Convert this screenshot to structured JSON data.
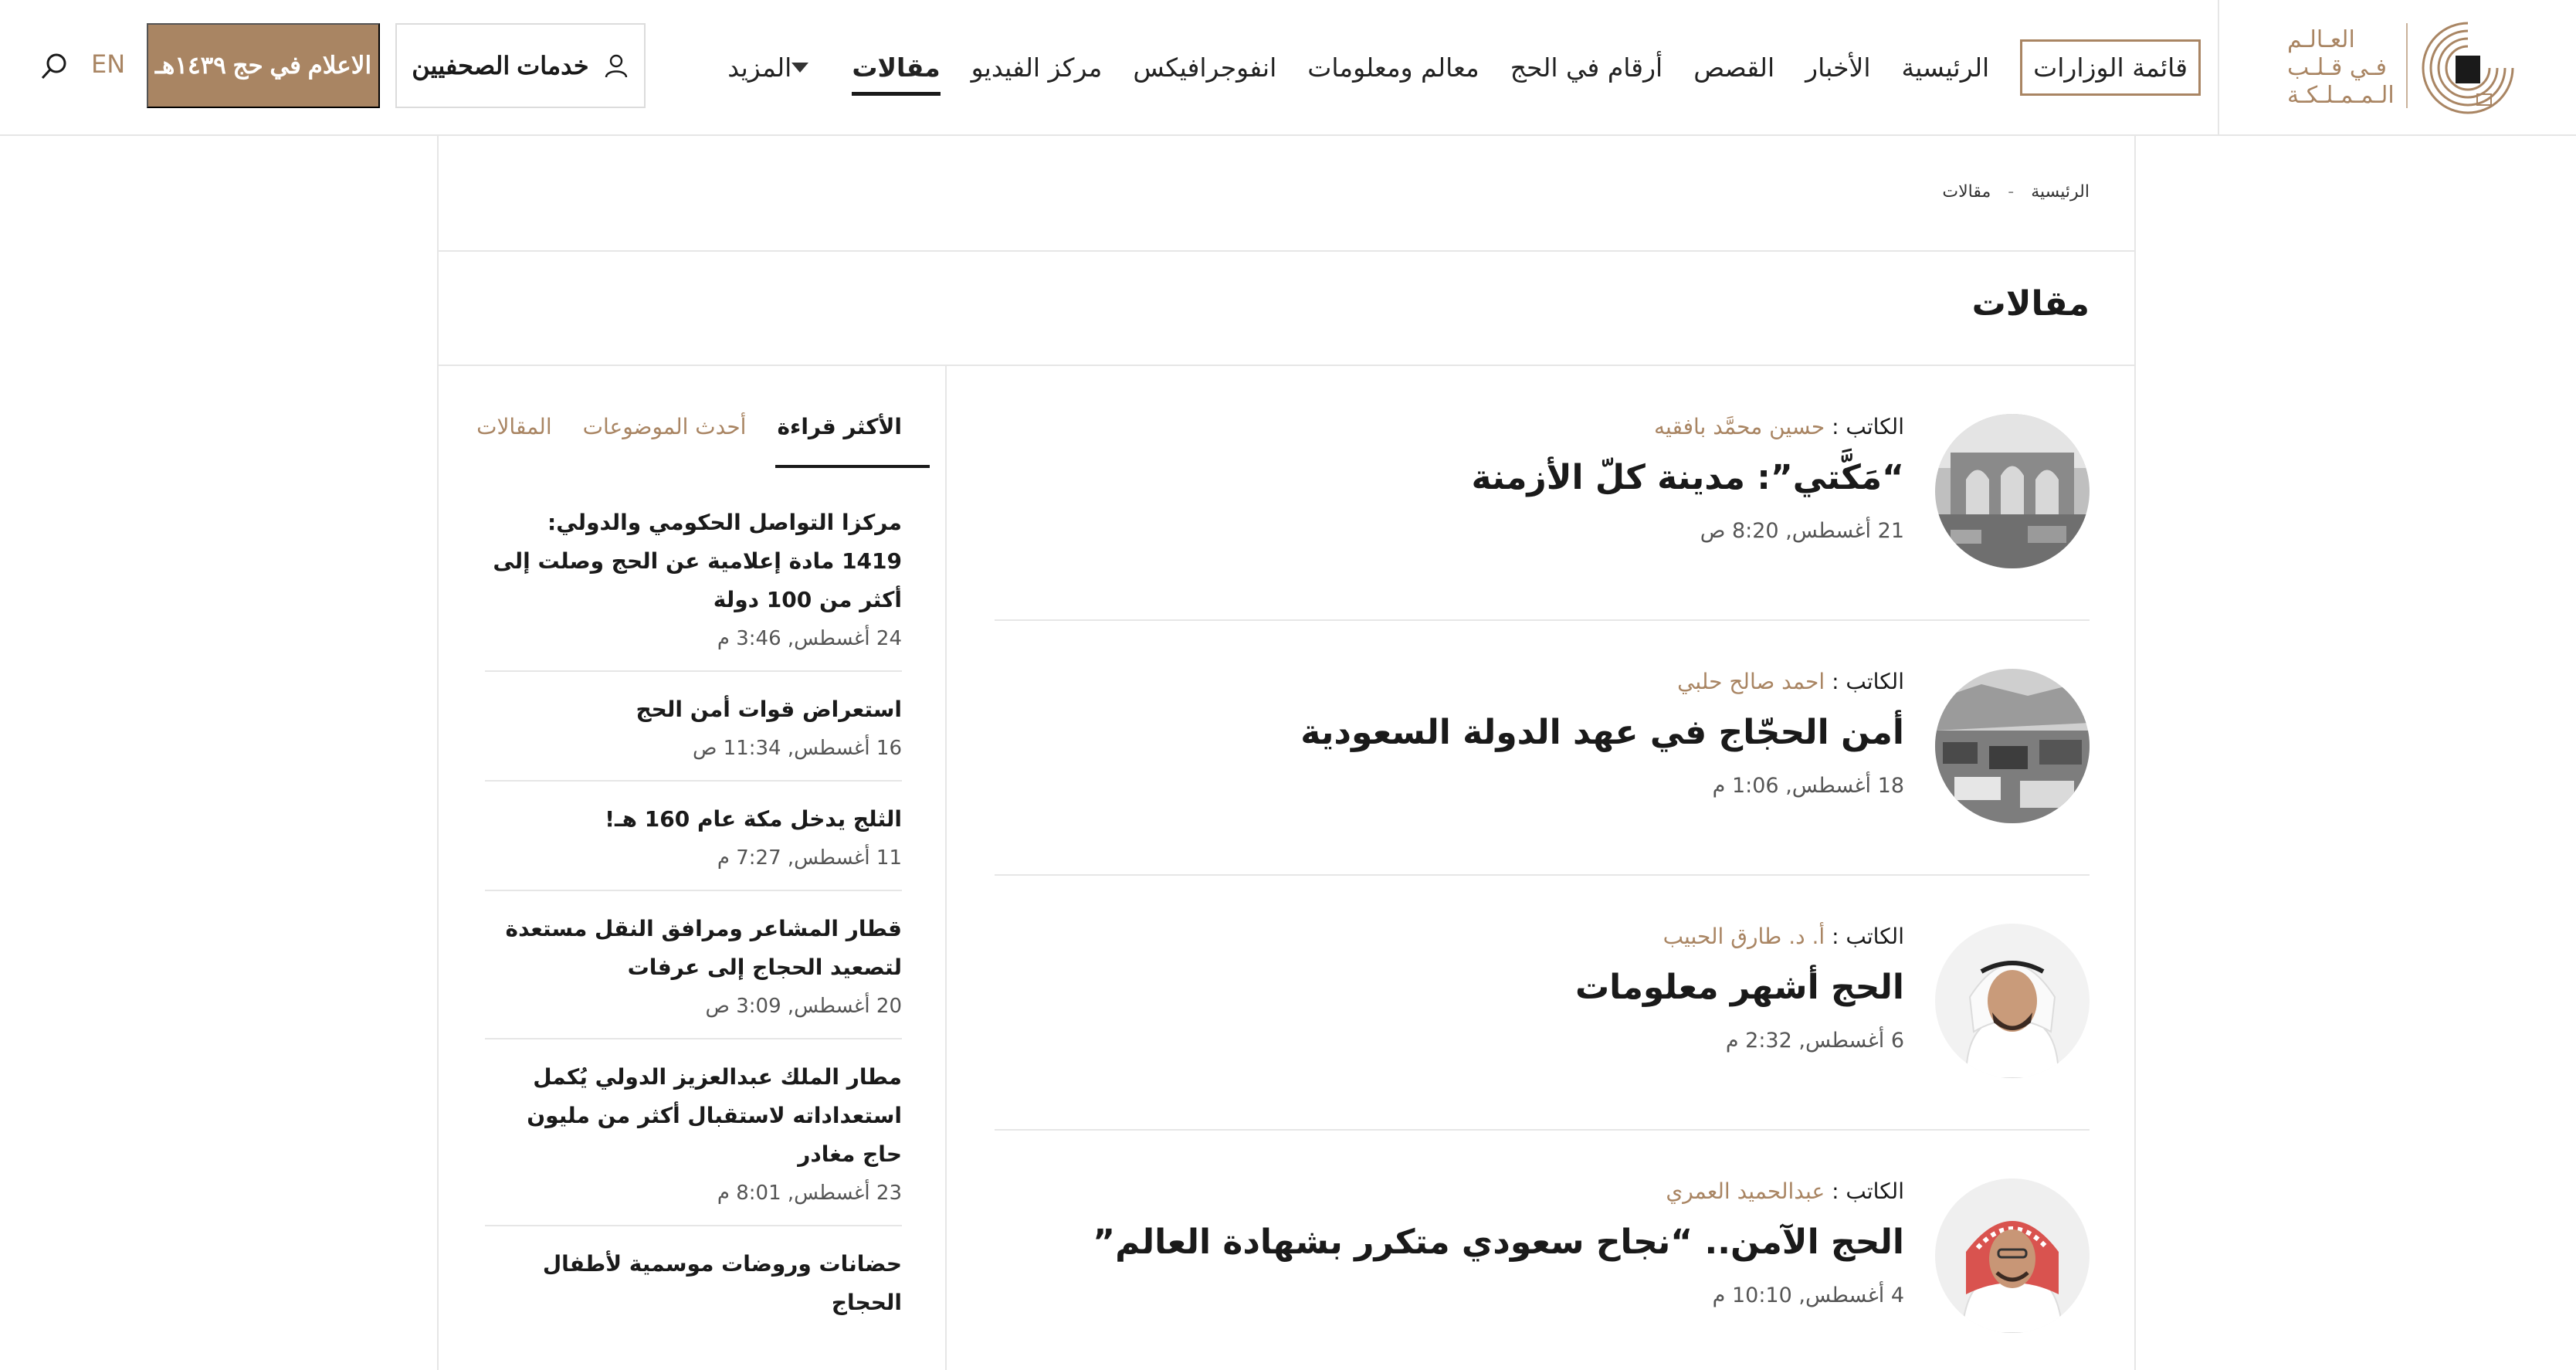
{
  "header": {
    "logo_lines": [
      "العـالـم",
      "فـي قـلـب",
      "الـمـمـلـكـة"
    ],
    "nav": [
      {
        "label": "قائمة الوزارات",
        "style": "boxed"
      },
      {
        "label": "الرئيسية"
      },
      {
        "label": "الأخبار"
      },
      {
        "label": "القصص"
      },
      {
        "label": "أرقام في الحج"
      },
      {
        "label": "معالم ومعلومات"
      },
      {
        "label": "انفوجرافيكس"
      },
      {
        "label": "مركز الفيديو"
      },
      {
        "label": "مقالات",
        "state": "active"
      },
      {
        "label": "المزيد",
        "dropdown": true
      }
    ],
    "journalist_services": "خدمات الصحفيين",
    "media_button": "الاعلام في حج ١٤٣٩هـ",
    "lang": "EN"
  },
  "breadcrumb": {
    "home": "الرئيسية",
    "separator": "-",
    "current": "مقالات"
  },
  "page_title": "مقالات",
  "articles": [
    {
      "writer_label": "الكاتب :",
      "author": "حسين محمَّد بافقيه",
      "title": "“مَكَّتي”: مدينة كلّ الأزمنة",
      "date": "21 أغسطس, 8:20 ص",
      "avatar": "old-city-photo"
    },
    {
      "writer_label": "الكاتب :",
      "author": "احمد صالح حلبي",
      "title": "أمن الحجّاج في عهد الدولة السعودية",
      "date": "18 أغسطس, 1:06 م",
      "avatar": "vintage-crowd-photo"
    },
    {
      "writer_label": "الكاتب :",
      "author": "أ. د. طارق الحبيب",
      "title": "الحج أشهر معلومات",
      "date": "6 أغسطس, 2:32 م",
      "avatar": "author-portrait"
    },
    {
      "writer_label": "الكاتب :",
      "author": "عبدالحميد العمري",
      "title": "الحج الآمن.. “نجاح سعودي متكرر بشهادة العالم”",
      "date": "4 أغسطس, 10:10 م",
      "avatar": "author-portrait"
    }
  ],
  "sidebar": {
    "tabs": [
      {
        "label": "الأكثر قراءة",
        "state": "active"
      },
      {
        "label": "أحدث الموضوعات"
      },
      {
        "label": "المقالات"
      }
    ],
    "items": [
      {
        "title": "مركزا التواصل الحكومي والدولي: 1419 مادة إعلامية عن الحج وصلت إلى أكثر من 100 دولة",
        "date": "24 أغسطس, 3:46 م"
      },
      {
        "title": "استعراض قوات أمن الحج",
        "date": "16 أغسطس, 11:34 ص"
      },
      {
        "title": "الثلج يدخل مكة عام 160 هـ!",
        "date": "11 أغسطس, 7:27 م"
      },
      {
        "title": "قطار المشاعر ومرافق النقل مستعدة لتصعيد الحجاج إلى عرفات",
        "date": "20 أغسطس, 3:09 ص"
      },
      {
        "title": "مطار الملك عبدالعزيز الدولي يُكمل استعداداته لاستقبال أكثر من مليون حاج مغادر",
        "date": "23 أغسطس, 8:01 م"
      },
      {
        "title": "حضانات وروضات موسمية لأطفال الحجاج",
        "date": ""
      }
    ]
  },
  "colors": {
    "accent": "#a98563",
    "text": "#1a1a1a",
    "border": "#e6e6e6"
  }
}
